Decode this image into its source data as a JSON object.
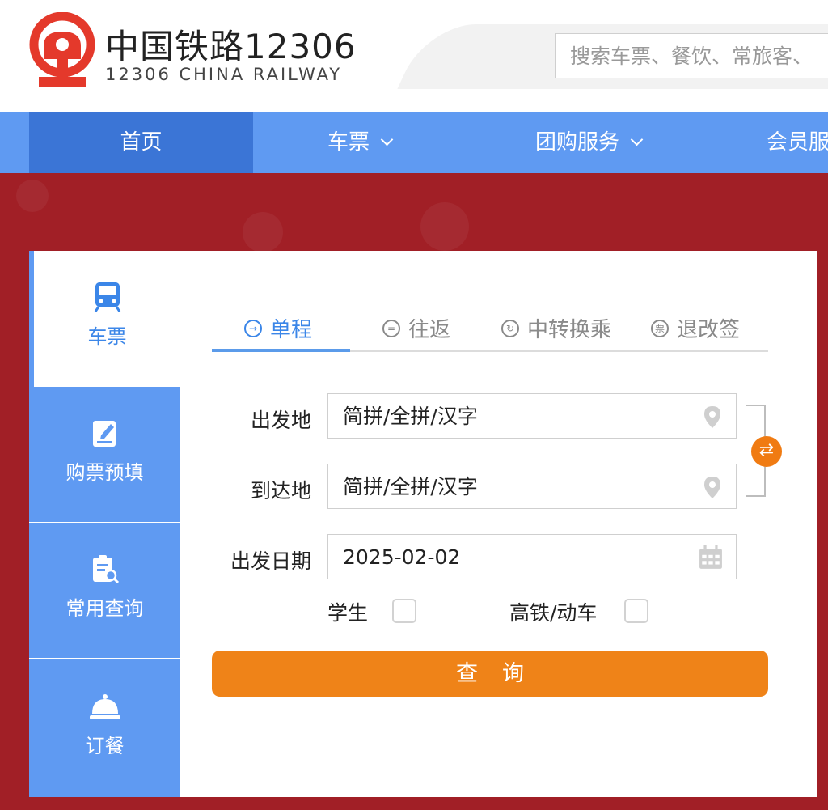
{
  "header": {
    "brand_cn": "中国铁路12306",
    "brand_en": "12306 CHINA RAILWAY",
    "search_placeholder": "搜索车票、餐饮、常旅客、"
  },
  "nav": {
    "items": [
      {
        "label": "首页",
        "active": true
      },
      {
        "label": "车票",
        "dropdown": true
      },
      {
        "label": "团购服务",
        "dropdown": true
      },
      {
        "label": "会员服"
      }
    ]
  },
  "sidebar": {
    "items": [
      {
        "label": "车票",
        "icon": "train-icon",
        "active": true
      },
      {
        "label": "购票预填",
        "icon": "edit-icon"
      },
      {
        "label": "常用查询",
        "icon": "clipboard-search-icon"
      },
      {
        "label": "订餐",
        "icon": "dining-bell-icon"
      }
    ]
  },
  "tabs": [
    {
      "label": "单程",
      "icon": "one-way-icon",
      "active": true
    },
    {
      "label": "往返",
      "icon": "round-trip-icon"
    },
    {
      "label": "中转换乘",
      "icon": "transfer-icon"
    },
    {
      "label": "退改签",
      "icon": "ticket-icon",
      "icon_text": "票"
    }
  ],
  "form": {
    "from_label": "出发地",
    "from_placeholder": "简拼/全拼/汉字",
    "to_label": "到达地",
    "to_placeholder": "简拼/全拼/汉字",
    "date_label": "出发日期",
    "date_value": "2025-02-02",
    "student_label": "学生",
    "student_checked": false,
    "highspeed_label": "高铁/动车",
    "highspeed_checked": false,
    "query_button": "查询"
  },
  "colors": {
    "brand_red": "#a11f26",
    "nav_blue": "#5f9af2",
    "nav_active": "#3b75d6",
    "accent_orange": "#ef8318",
    "tab_active": "#3b86e8"
  }
}
